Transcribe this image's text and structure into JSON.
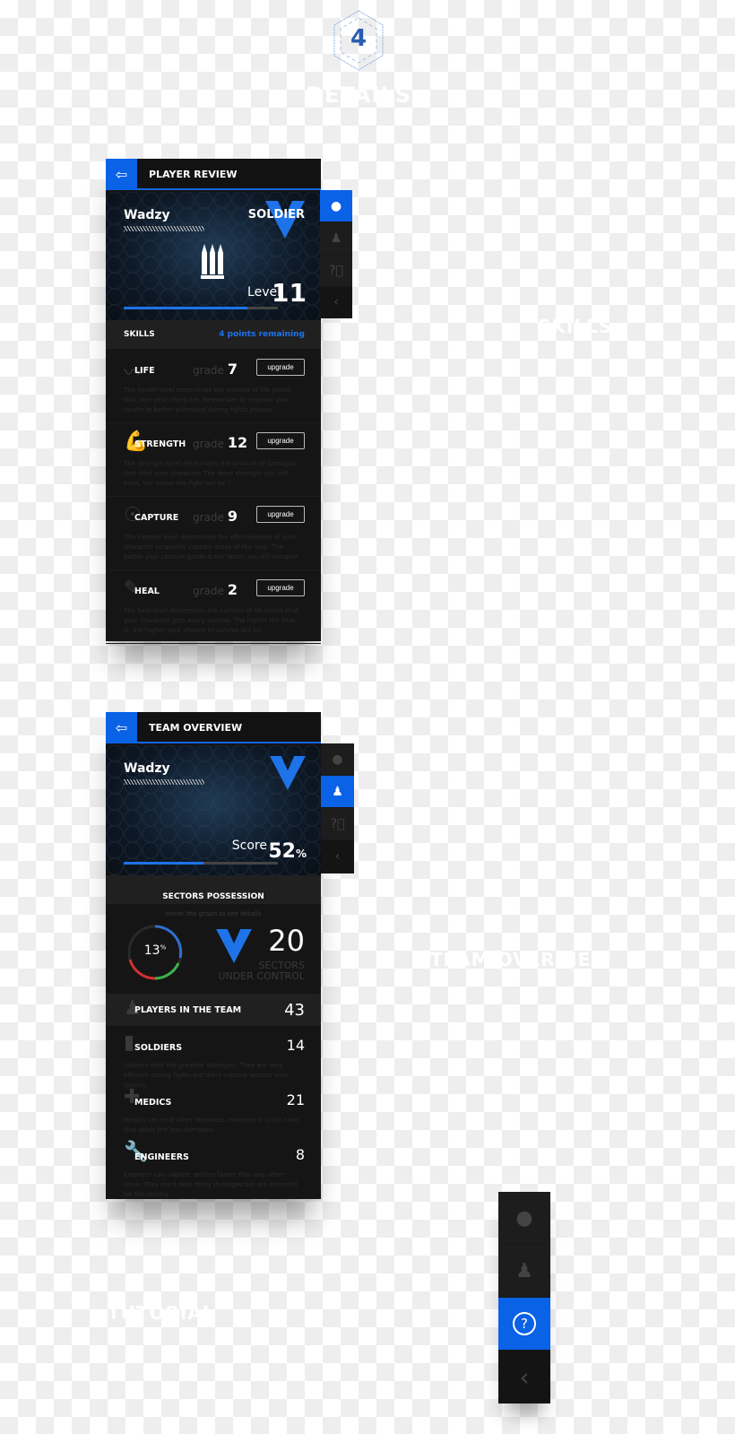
{
  "page": {
    "step": "4",
    "title": "DETAILS",
    "accent": "#0a62e6"
  },
  "sections": {
    "skills": "SKILLS",
    "team": "TEAM OVERVIEW",
    "tutorial": "TUTORIAL"
  },
  "player_review": {
    "header": "PLAYER REVIEW",
    "back_icon": "exit-icon",
    "name": "Wadzy",
    "class": "SOLDIER",
    "level_label": "Level",
    "level": "11",
    "level_progress": 0.8,
    "skills_label": "SKILLS",
    "points_remaining": "4 points remaining",
    "grade_label": "grade",
    "upgrade_label": "upgrade",
    "skills": [
      {
        "label": "LIFE",
        "icon": "heartbeat-icon",
        "grade": "7",
        "desc": "The health level determines the amount of life points that own your character. Remember to improve your health to better withstand during fights phases."
      },
      {
        "label": "STRENGTH",
        "icon": "muscle-icon",
        "grade": "12",
        "desc": "The strength level determines the amount of damages that deal your character. The more strength you will have, the easier the fight will be !"
      },
      {
        "label": "CAPTURE",
        "icon": "head-gear-icon",
        "grade": "9",
        "desc": "The capture level determines the effectiveness of your character to quickly capture areas of the map. The better your capture grade is the faster you will conquer."
      },
      {
        "label": "HEAL",
        "icon": "syringe-icon",
        "grade": "2",
        "desc": "The heal level determines the number of hit points that your character gets every second. The higher the heal is, the higher your chance to survive will be."
      }
    ]
  },
  "team_overview": {
    "header": "TEAM OVERVIEW",
    "name": "Wadzy",
    "score_label": "Score",
    "score": "52",
    "score_unit": "%",
    "score_progress": 0.52,
    "sectors_label": "SECTORS POSSESSION",
    "hover_hint": "Hover the graph to see détails",
    "donut_percent": "13",
    "donut_unit": "%",
    "sectors": "20",
    "sectors_line1": "SECTORS",
    "sectors_line2": "UNDER CONTROL",
    "players_label": "PLAYERS IN THE TEAM",
    "players": "43",
    "classes": [
      {
        "label": "SOLDIERS",
        "icon": "bullets-icon",
        "count": "14",
        "desc": "Soldiers deal the greatest damages. They are very efficient during fights but don't capture sectors very quickly."
      },
      {
        "label": "MEDICS",
        "icon": "medical-cross-icon",
        "count": "21",
        "desc": "Medics can heal other teamates. However it is the class that deals the less damages."
      },
      {
        "label": "ENGINEERS",
        "icon": "wrench-icon",
        "count": "8",
        "desc": "Engineer can capture sectors faster than any other class. They don't deal many damages but are essential for the victory."
      }
    ]
  },
  "side_tabs": [
    "player-tab",
    "team-tab",
    "help-tab",
    "collapse-tab"
  ]
}
